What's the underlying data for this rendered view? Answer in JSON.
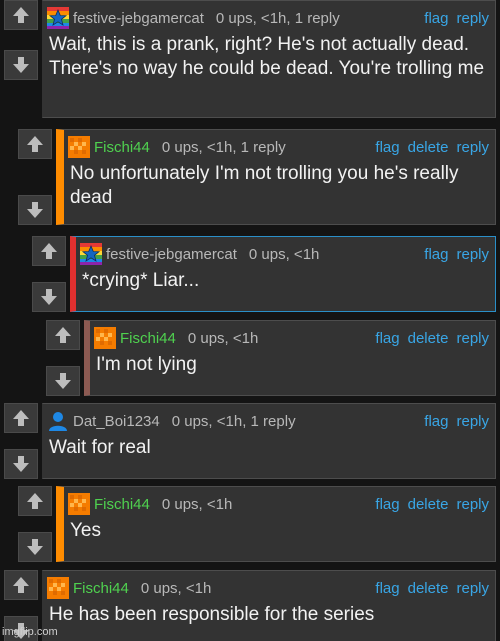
{
  "comments": [
    {
      "username": "festive-jebgamercat",
      "meta": "0 ups, <1h, 1 reply",
      "actions": [
        "flag",
        "reply"
      ],
      "text": "Wait, this is a prank, right? He's not actually dead. There's no way he could be dead. You're trolling me",
      "avatar": "rainbow-star-icon",
      "accent": "#2b2b2b",
      "name_color": "#b8b8b8"
    },
    {
      "username": "Fischi44",
      "meta": "0 ups, <1h, 1 reply",
      "actions": [
        "flag",
        "delete",
        "reply"
      ],
      "text": "No unfortunately I'm not trolling you he's really dead",
      "avatar": "orange-checker-icon",
      "accent": "#ff8c00",
      "name_color": "#4fd14f"
    },
    {
      "username": "festive-jebgamercat",
      "meta": "0 ups, <1h",
      "actions": [
        "flag",
        "reply"
      ],
      "text": "*crying* Liar...",
      "avatar": "rainbow-star-icon",
      "accent": "#e0302f",
      "name_color": "#b8b8b8"
    },
    {
      "username": "Fischi44",
      "meta": "0 ups, <1h",
      "actions": [
        "flag",
        "delete",
        "reply"
      ],
      "text": "I'm not lying",
      "avatar": "orange-checker-icon",
      "accent": "#8c5a52",
      "name_color": "#4fd14f"
    },
    {
      "username": "Dat_Boi1234",
      "meta": "0 ups, <1h, 1 reply",
      "actions": [
        "flag",
        "reply"
      ],
      "text": "Wait for real",
      "avatar": "blue-user-icon",
      "accent": "#2b2b2b",
      "name_color": "#b8b8b8"
    },
    {
      "username": "Fischi44",
      "meta": "0 ups, <1h",
      "actions": [
        "flag",
        "delete",
        "reply"
      ],
      "text": "Yes",
      "avatar": "orange-checker-icon",
      "accent": "#ff8c00",
      "name_color": "#4fd14f"
    },
    {
      "username": "Fischi44",
      "meta": "0 ups, <1h",
      "actions": [
        "flag",
        "delete",
        "reply"
      ],
      "text": "He has been responsible for the series",
      "avatar": "orange-checker-icon",
      "accent": "#2b2b2b",
      "name_color": "#4fd14f"
    }
  ],
  "watermark": "imgflip.com"
}
